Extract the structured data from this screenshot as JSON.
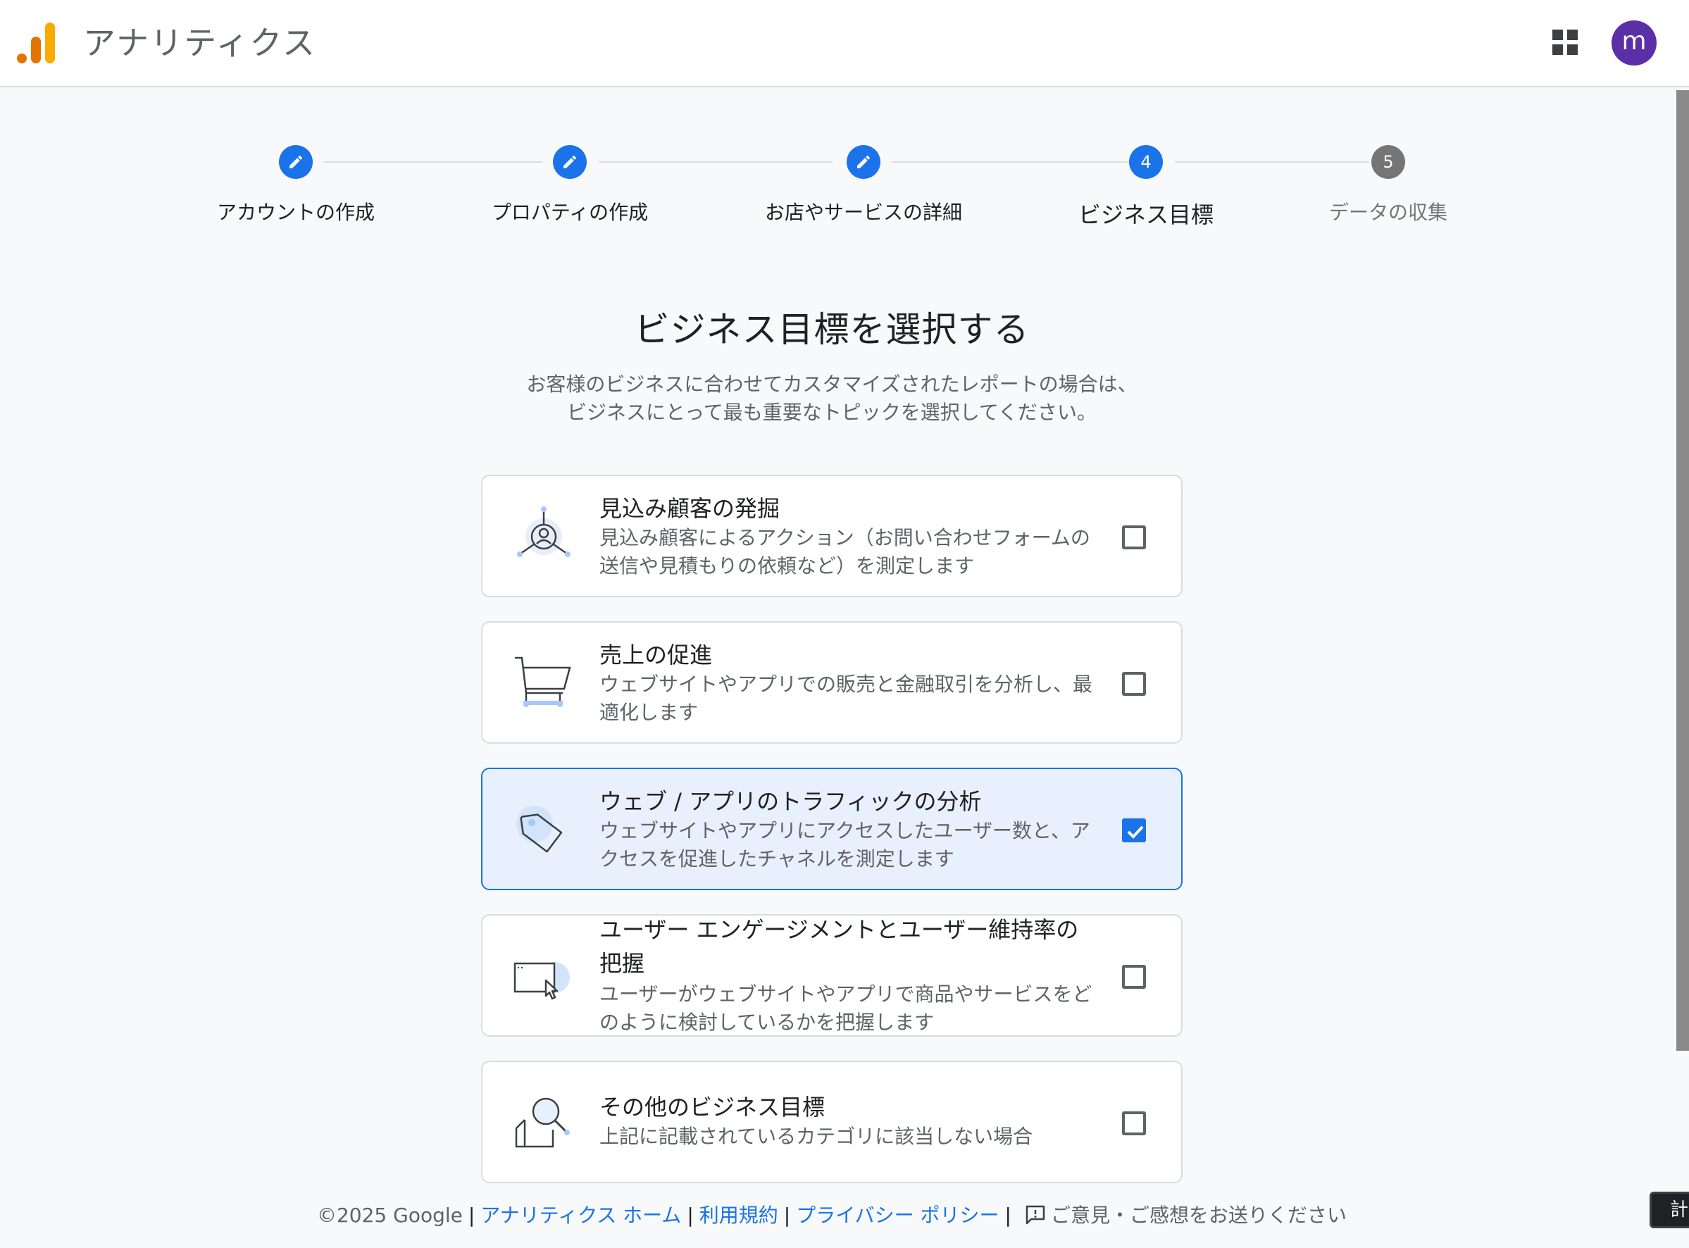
{
  "header": {
    "app_title": "アナリティクス",
    "avatar_letter": "m"
  },
  "steps": [
    {
      "label": "アカウントの作成",
      "status": "done"
    },
    {
      "label": "プロパティの作成",
      "status": "done"
    },
    {
      "label": "お店やサービスの詳細",
      "status": "done"
    },
    {
      "label": "ビジネス目標",
      "number": "4",
      "status": "current"
    },
    {
      "label": "データの収集",
      "number": "5",
      "status": "pending"
    }
  ],
  "main": {
    "heading": "ビジネス目標を選択する",
    "subtext_line1": "お客様のビジネスに合わせてカスタマイズされたレポートの場合は、",
    "subtext_line2": "ビジネスにとって最も重要なトピックを選択してください。"
  },
  "goals": [
    {
      "title": "見込み顧客の発掘",
      "desc": "見込み顧客によるアクション（お問い合わせフォームの送信や見積もりの依頼など）を測定します",
      "checked": false,
      "icon": "target-person-icon"
    },
    {
      "title": "売上の促進",
      "desc": "ウェブサイトやアプリでの販売と金融取引を分析し、最適化します",
      "checked": false,
      "icon": "shopping-cart-icon"
    },
    {
      "title": "ウェブ / アプリのトラフィックの分析",
      "desc": "ウェブサイトやアプリにアクセスしたユーザー数と、アクセスを促進したチャネルを測定します",
      "checked": true,
      "icon": "tag-icon"
    },
    {
      "title": "ユーザー エンゲージメントとユーザー維持率の把握",
      "desc": "ユーザーがウェブサイトやアプリで商品やサービスをどのように検討しているかを把握します",
      "checked": false,
      "icon": "browser-cursor-icon"
    },
    {
      "title": "その他のビジネス目標",
      "desc": "上記に記載されているカテゴリに該当しない場合",
      "checked": false,
      "icon": "magnifier-icon"
    }
  ],
  "footer": {
    "copyright": "©2025 Google",
    "links": [
      "アナリティクス ホーム",
      "利用規約",
      "プライバシー ポリシー"
    ],
    "feedback": "ご意見・ご感想をお送りください",
    "corner_text": "計"
  },
  "colors": {
    "accent": "#1a73e8",
    "avatar_bg": "#5b2fa8",
    "selected_card_bg": "#e8f0fe",
    "logo_orange": "#e37400",
    "logo_yellow": "#f9ab00"
  }
}
